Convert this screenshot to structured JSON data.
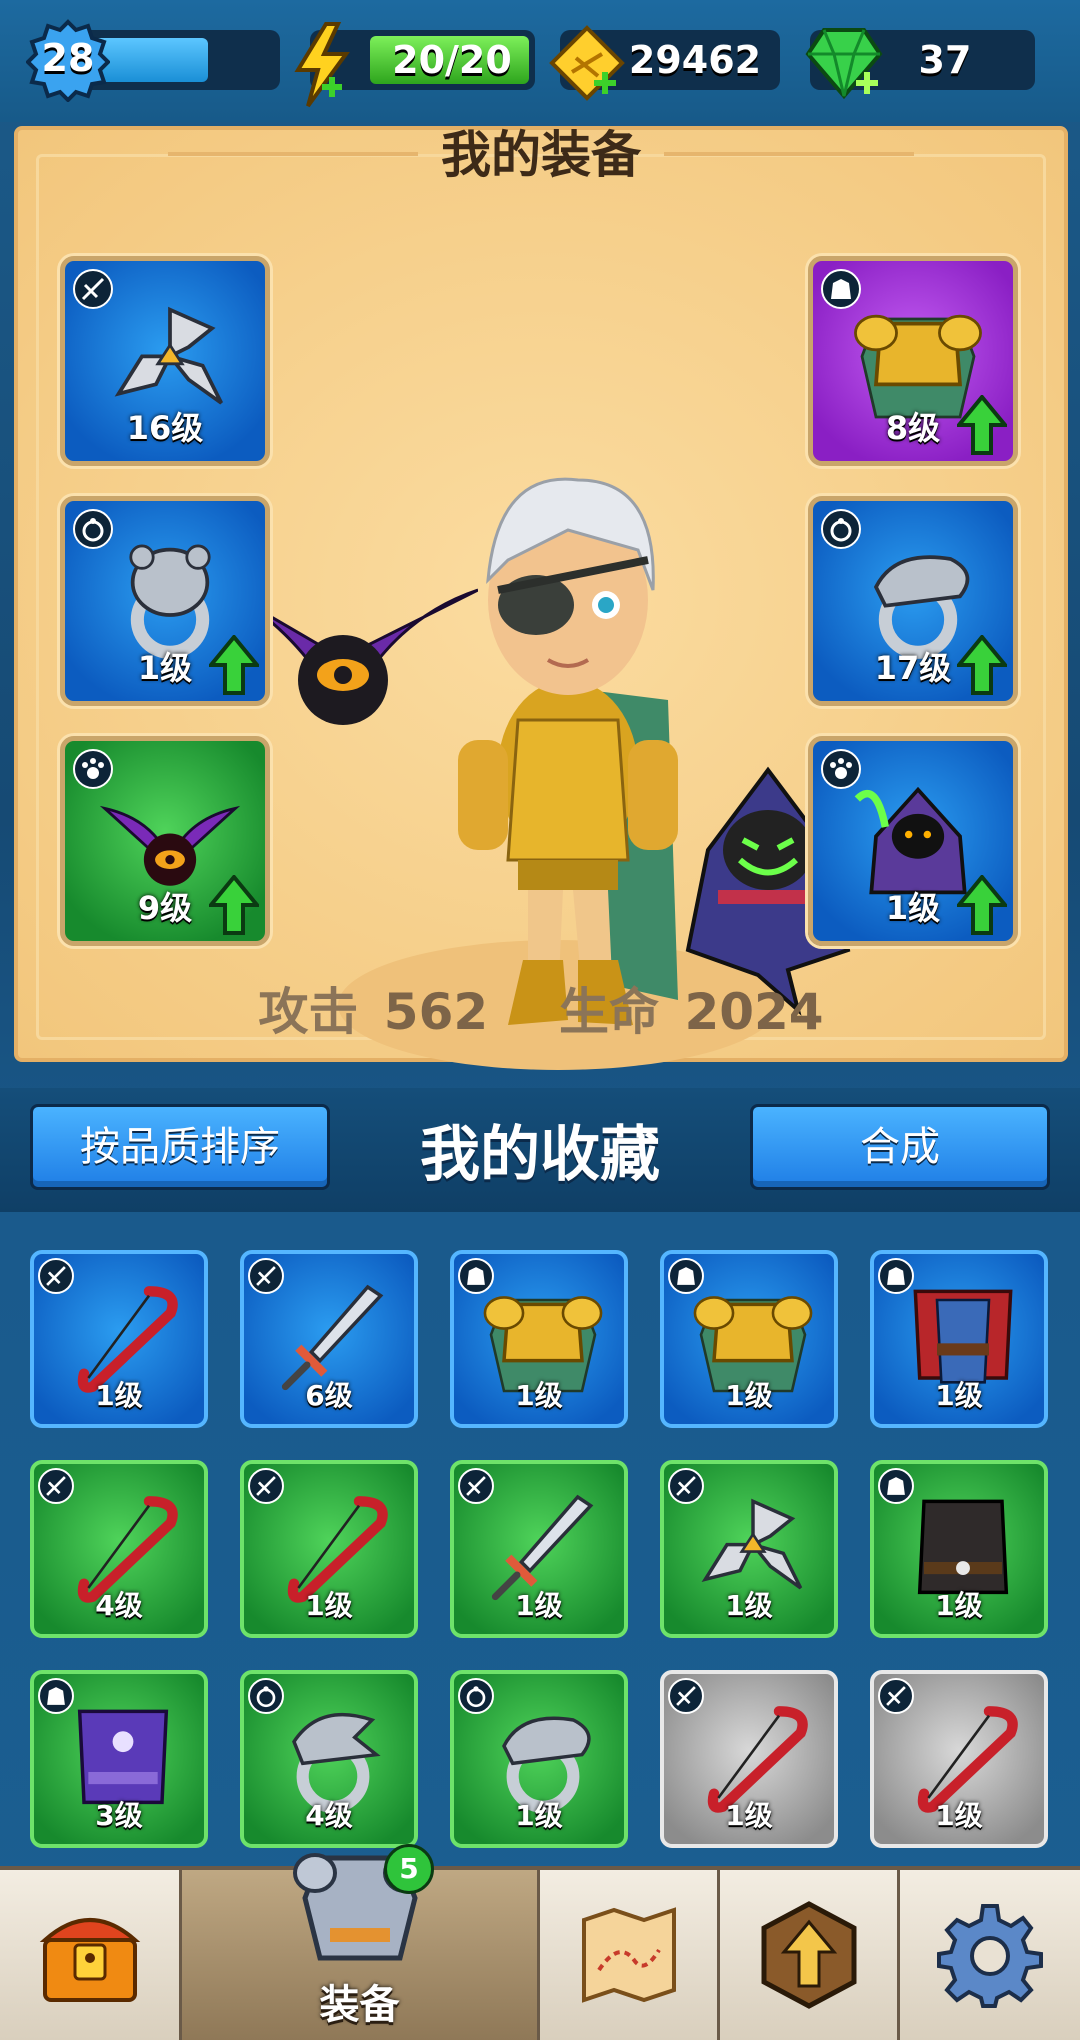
{
  "top_bar": {
    "level": "28",
    "level_progress": 0.7,
    "energy": "20/20",
    "gold": "29462",
    "gems": "37"
  },
  "equipment": {
    "title": "我的装备",
    "attack_label": "攻击",
    "attack_value": "562",
    "hp_label": "生命",
    "hp_value": "2024",
    "slots": [
      {
        "type": "weapon-icon",
        "rarity": "blue",
        "item": "shuriken-icon",
        "level": "16级",
        "upgrade": false
      },
      {
        "type": "armor-icon",
        "rarity": "purple",
        "item": "gold-armor-icon",
        "level": "8级",
        "upgrade": true
      },
      {
        "type": "ring-icon",
        "rarity": "blue",
        "item": "bear-ring-icon",
        "level": "1级",
        "upgrade": true
      },
      {
        "type": "ring-icon",
        "rarity": "blue",
        "item": "serpent-ring-icon",
        "level": "17级",
        "upgrade": true
      },
      {
        "type": "pet-icon",
        "rarity": "green",
        "item": "bat-pet-icon",
        "level": "9级",
        "upgrade": true
      },
      {
        "type": "pet-icon",
        "rarity": "blue",
        "item": "reaper-pet-icon",
        "level": "1级",
        "upgrade": true
      }
    ]
  },
  "collection": {
    "title": "我的收藏",
    "sort_label": "按品质排序",
    "merge_label": "合成",
    "items": [
      {
        "type": "weapon-icon",
        "rarity": "blue",
        "item": "bow-icon",
        "level": "1级"
      },
      {
        "type": "weapon-icon",
        "rarity": "blue",
        "item": "sword-icon",
        "level": "6级"
      },
      {
        "type": "armor-icon",
        "rarity": "blue",
        "item": "gold-armor-icon",
        "level": "1级"
      },
      {
        "type": "armor-icon",
        "rarity": "blue",
        "item": "gold-armor-icon",
        "level": "1级"
      },
      {
        "type": "armor-icon",
        "rarity": "blue",
        "item": "red-robe-icon",
        "level": "1级"
      },
      {
        "type": "weapon-icon",
        "rarity": "green",
        "item": "bow-icon",
        "level": "4级"
      },
      {
        "type": "weapon-icon",
        "rarity": "green",
        "item": "bow-icon",
        "level": "1级"
      },
      {
        "type": "weapon-icon",
        "rarity": "green",
        "item": "sword-icon",
        "level": "1级"
      },
      {
        "type": "weapon-icon",
        "rarity": "green",
        "item": "shuriken-icon",
        "level": "1级"
      },
      {
        "type": "armor-icon",
        "rarity": "green",
        "item": "dark-vest-icon",
        "level": "1级"
      },
      {
        "type": "armor-icon",
        "rarity": "green",
        "item": "purple-robe-icon",
        "level": "3级"
      },
      {
        "type": "ring-icon",
        "rarity": "green",
        "item": "eagle-ring-icon",
        "level": "4级"
      },
      {
        "type": "ring-icon",
        "rarity": "green",
        "item": "serpent-ring-icon",
        "level": "1级"
      },
      {
        "type": "weapon-icon",
        "rarity": "gray",
        "item": "bow-icon",
        "level": "1级"
      },
      {
        "type": "weapon-icon",
        "rarity": "gray",
        "item": "bow-icon",
        "level": "1级"
      }
    ]
  },
  "bottom_nav": {
    "items": [
      {
        "icon": "treasure-chest-icon"
      },
      {
        "icon": "armor-icon",
        "label": "装备",
        "badge": "5",
        "active": true
      },
      {
        "icon": "map-icon"
      },
      {
        "icon": "upgrade-arrow-icon"
      },
      {
        "icon": "gear-icon"
      }
    ]
  }
}
